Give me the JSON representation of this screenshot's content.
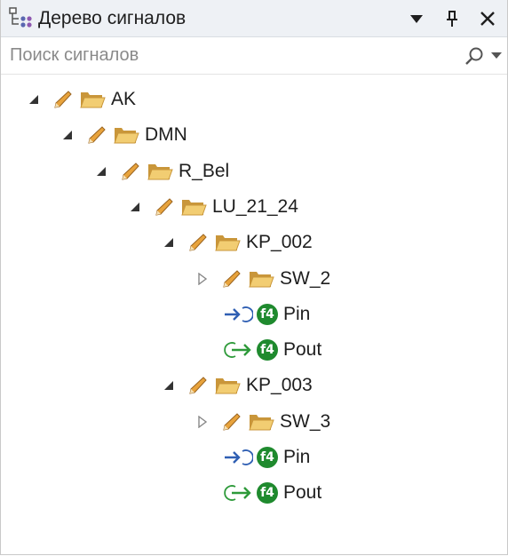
{
  "panel": {
    "title": "Дерево сигналов",
    "title_icon": "signal-tree-icon"
  },
  "search": {
    "placeholder": "Поиск сигналов",
    "value": "",
    "icon": "search-icon"
  },
  "tree": {
    "nodes": [
      {
        "label": "AK",
        "type": "folder",
        "state": "expanded"
      },
      {
        "label": "DMN",
        "type": "folder",
        "state": "expanded"
      },
      {
        "label": "R_Bel",
        "type": "folder",
        "state": "expanded"
      },
      {
        "label": "LU_21_24",
        "type": "folder",
        "state": "expanded"
      },
      {
        "label": "KP_002",
        "type": "folder",
        "state": "expanded"
      },
      {
        "label": "SW_2",
        "type": "folder",
        "state": "collapsed"
      },
      {
        "label": "Pin",
        "type": "signal-in",
        "badge": "f4"
      },
      {
        "label": "Pout",
        "type": "signal-out",
        "badge": "f4"
      },
      {
        "label": "KP_003",
        "type": "folder",
        "state": "expanded"
      },
      {
        "label": "SW_3",
        "type": "folder",
        "state": "collapsed"
      },
      {
        "label": "Pin",
        "type": "signal-in",
        "badge": "f4"
      },
      {
        "label": "Pout",
        "type": "signal-out",
        "badge": "f4"
      }
    ]
  },
  "colors": {
    "folder": "#f2cd72",
    "folder_edge": "#c9963a",
    "pencil": "#e8a33c",
    "badge_green": "#1f8a2e",
    "arrow_in": "#2f5fb3",
    "arrow_out": "#2e9a3a"
  }
}
